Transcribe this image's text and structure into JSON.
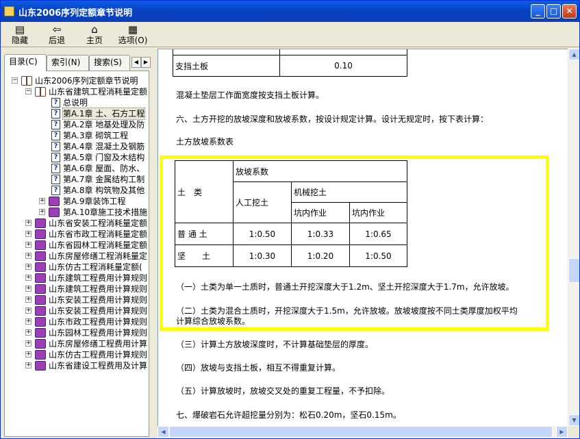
{
  "window": {
    "title": "山东2006序列定额章节说明"
  },
  "toolbar": {
    "hide": "隐藏",
    "back": "后退",
    "home": "主页",
    "options": "选项(O)"
  },
  "tabs": {
    "contents": "目录(C)",
    "index": "索引(N)",
    "search": "搜索(S)"
  },
  "tree": {
    "root": "山东2006序列定额章节说明",
    "group1": "山东省建筑工程消耗量定额",
    "items": [
      "总说明",
      "第A.1章 土、石方工程",
      "第A.2章 地基处理及防",
      "第A.3章 砌筑工程",
      "第A.4章 混凝土及钢筋",
      "第A.5章 门窗及木结构",
      "第A.6章 屋面、防水、",
      "第A.7章 金属结构工制",
      "第A.8章 构筑物及其他"
    ],
    "sub": [
      "第A.9章装饰工程",
      "第A.10章施工技术措施"
    ],
    "books": [
      "山东省安装工程消耗量定额",
      "山东省市政工程消耗量定额",
      "山东省园林工程消耗量定额",
      "山东房屋修缮工程消耗量定",
      "山东仿古工程消耗量定额(",
      "山东建筑工程费用计算规则",
      "山东建筑工程费用计算规则",
      "山东安装工程费用计算规则",
      "山东安装工程费用计算规则",
      "山东市政工程费用计算规则",
      "山东园林工程费用计算规则",
      "山东房屋修缮工程费用计算",
      "山东仿古工程费用计算规则",
      "山东省建设工程费用及计算"
    ]
  },
  "content": {
    "top_table": {
      "label": "支挡土板",
      "value": "0.10"
    },
    "para1": "混凝土垫层工作面宽度按支挡土板计算。",
    "para2": "六、土方开挖的放坡深度和放坡系数，按设计规定计算。设计无规定时，按下表计算：",
    "table_title": "土方放坡系数表",
    "slope_table": {
      "col_soil": "土　类",
      "col_coef": "放坡系数",
      "col_manual": "人工挖土",
      "col_machine": "机械挖土",
      "col_in_pit": "坑内作业",
      "col_in_pit2": "坑内作业",
      "rows": [
        {
          "soil": "普 通 土",
          "manual": "1:0.50",
          "in_pit": "1:0.33",
          "in_pit2": "1:0.65"
        },
        {
          "soil": "坚　　土",
          "manual": "1:0.30",
          "in_pit": "1:0.20",
          "in_pit2": "1:0.50"
        }
      ]
    },
    "note1": "（一）土类为单一土质时，普通土开挖深度大于1.2m、坚土开挖深度大于1.7m，允许放坡。",
    "note2a": "（二）土类为混合土质时，开挖深度大于1.5m，允许放坡。放坡坡度按不同土类厚度加权平均",
    "note2b": "计算综合放坡系数。",
    "note3": "（三）计算土方放坡深度时，不计算基础垫层的厚度。",
    "note4": "（四）放坡与支挡土板，相互不得重复计算。",
    "note5": "（五）计算放坡时，放坡交叉处的重复工程量，不予扣除。",
    "para7": "七、爆破岩石允许超挖量分别为：松石0.20m，坚石0.15m。"
  }
}
